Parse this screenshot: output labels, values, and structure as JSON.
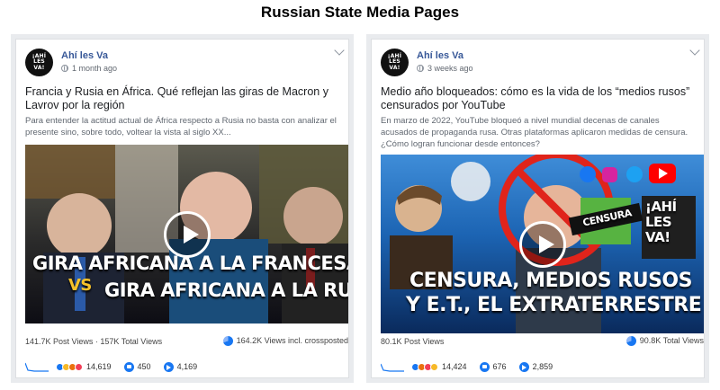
{
  "page_title": "Russian State Media Pages",
  "posts": [
    {
      "page_name": "Ahí les Va",
      "avatar_text": [
        "¡AHÍ",
        "LES",
        "VA!"
      ],
      "time": "1 month ago",
      "title": "Francia y Rusia en África. Qué reflejan las giras de Macron y Lavrov por la región",
      "description": "Para entender la actitud actual de África respecto a Rusia no basta con analizar el presente sino, sobre todo, voltear la vista al siglo XX...",
      "thumb_lines": [
        "GIRA AFRICANA A LA FRANCESA",
        "VS",
        "GIRA AFRICANA A LA RUSA"
      ],
      "post_views": "141.7K Post Views · 157K Total Views",
      "crossposted": "164.2K Views incl. crossposted",
      "reactions": "14,619",
      "comments": "450",
      "shares": "4,169"
    },
    {
      "page_name": "Ahí les Va",
      "avatar_text": [
        "¡AHÍ",
        "LES",
        "VA!"
      ],
      "time": "3 weeks ago",
      "title": "Medio año bloqueados: cómo es la vida de los “medios rusos” censurados por YouTube",
      "description": "En marzo de 2022, YouTube bloqueó a nivel mundial decenas de canales acusados de propaganda rusa. Otras plataformas aplicaron medidas de censura. ¿Cómo logran funcionar desde entonces?",
      "thumb_lines": [
        "CENSURA, MEDIOS RUSOS",
        "Y E.T., EL EXTRATERRESTRE",
        "CENSURA",
        "¡AHÍ LES VA!"
      ],
      "post_views": "80.1K Post Views",
      "crossposted": "90.8K Total Views",
      "reactions": "14,424",
      "comments": "676",
      "shares": "2,859"
    }
  ],
  "colors": {
    "link": "#385898",
    "accent": "#1877f2",
    "meta": "#616770"
  }
}
